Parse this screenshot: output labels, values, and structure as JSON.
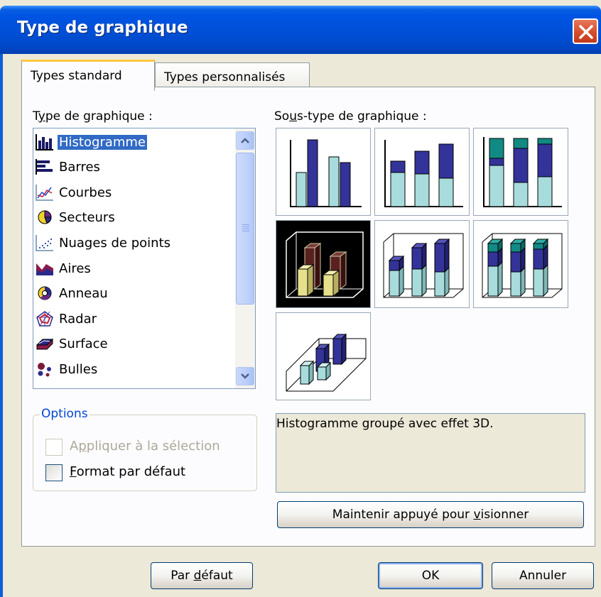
{
  "window": {
    "title": "Type de graphique",
    "close_icon": "close-icon"
  },
  "tabs": [
    {
      "label": "Types standard",
      "active": true
    },
    {
      "label": "Types personnalisés",
      "active": false
    }
  ],
  "chart_type": {
    "label_pre": "T",
    "label_ul": "y",
    "label_post": "pe de graphique :",
    "items": [
      {
        "label": "Histogramme",
        "icon": "column-chart-icon",
        "selected": true
      },
      {
        "label": "Barres",
        "icon": "bar-chart-icon"
      },
      {
        "label": "Courbes",
        "icon": "line-chart-icon"
      },
      {
        "label": "Secteurs",
        "icon": "pie-chart-icon"
      },
      {
        "label": "Nuages de points",
        "icon": "scatter-chart-icon"
      },
      {
        "label": "Aires",
        "icon": "area-chart-icon"
      },
      {
        "label": "Anneau",
        "icon": "doughnut-chart-icon"
      },
      {
        "label": "Radar",
        "icon": "radar-chart-icon"
      },
      {
        "label": "Surface",
        "icon": "surface-chart-icon"
      },
      {
        "label": "Bulles",
        "icon": "bubble-chart-icon"
      }
    ]
  },
  "subtype": {
    "label_pre": "So",
    "label_ul": "u",
    "label_post": "s-type de graphique :",
    "selected_index": 3,
    "description": "Histogramme groupé avec effet 3D."
  },
  "options": {
    "legend": "Options",
    "apply_pre": "A",
    "apply_ul": "p",
    "apply_post": "pliquer à la sélection",
    "apply_enabled": false,
    "apply_checked": false,
    "format_pre": "",
    "format_ul": "F",
    "format_post": "ormat par défaut",
    "format_checked": false
  },
  "buttons": {
    "preview_pre": "Maintenir appuyé pour ",
    "preview_ul": "v",
    "preview_post": "isionner",
    "default_pre": "Par ",
    "default_ul": "d",
    "default_post": "éfaut",
    "ok": "OK",
    "cancel": "Annuler"
  },
  "colors": {
    "titlebar": "#0054e3",
    "selection": "#316ac5",
    "series_dark": "#33339a",
    "series_light": "#a8dcdc",
    "series_teal": "#128a84",
    "selected_3d_light": "#e6e08c",
    "selected_3d_dark": "#5a2020"
  }
}
